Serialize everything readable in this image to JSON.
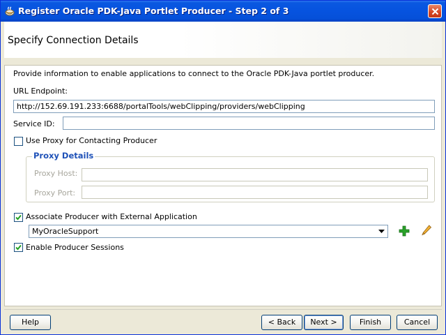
{
  "window": {
    "title": "Register Oracle PDK-Java Portlet Producer - Step 2 of 3"
  },
  "header": {
    "title": "Specify Connection Details"
  },
  "content": {
    "intro": "Provide information to enable applications to connect to the Oracle PDK-Java portlet producer.",
    "url_label": "URL Endpoint:",
    "url_value": "http://152.69.191.233:6688/portalTools/webClipping/providers/webClipping",
    "service_id_label": "Service ID:",
    "service_id_value": "",
    "use_proxy": {
      "label": "Use Proxy for Contacting Producer",
      "checked": false
    },
    "proxy_details": {
      "title": "Proxy Details",
      "host_label": "Proxy Host:",
      "host_value": "",
      "port_label": "Proxy Port:",
      "port_value": ""
    },
    "associate": {
      "label": "Associate Producer with External Application",
      "checked": true
    },
    "external_app": {
      "selected": "MyOracleSupport"
    },
    "sessions": {
      "label": "Enable Producer Sessions",
      "checked": true
    }
  },
  "buttons": {
    "help": "Help",
    "back": "< Back",
    "next": "Next >",
    "finish": "Finish",
    "cancel": "Cancel"
  },
  "icons": {
    "add": "add-icon",
    "edit": "pencil-icon"
  },
  "colors": {
    "titlebar": "#0653df",
    "group_title": "#1f52b8",
    "add_icon": "#2aa32a"
  }
}
